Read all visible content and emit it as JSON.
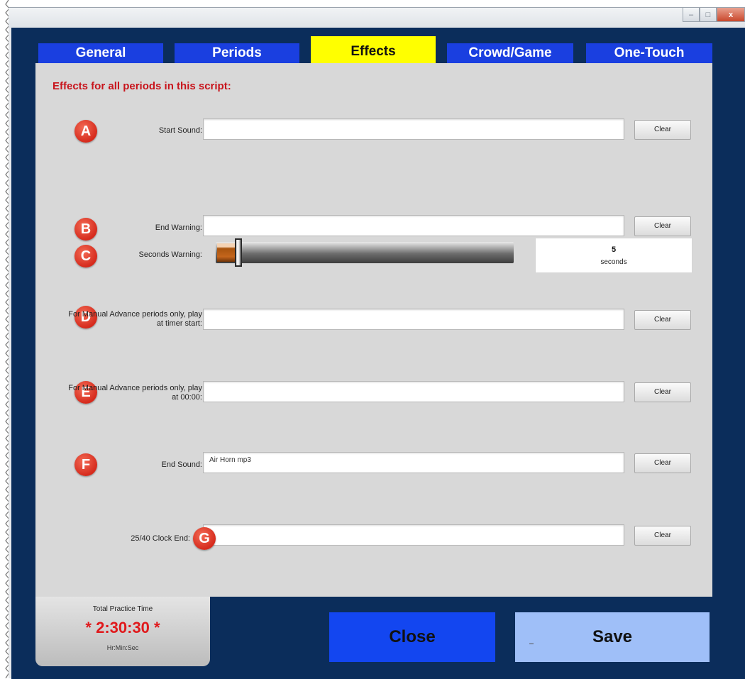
{
  "window": {
    "controls": {
      "minimize": "–",
      "maximize": "□",
      "close": "x"
    }
  },
  "tabs": [
    {
      "label": "General",
      "active": false
    },
    {
      "label": "Periods",
      "active": false
    },
    {
      "label": "Effects",
      "active": true
    },
    {
      "label": "Crowd/Game",
      "active": false
    },
    {
      "label": "One-Touch",
      "active": false
    }
  ],
  "panel": {
    "heading": "Effects for all periods in this script:",
    "rows": {
      "start_sound": {
        "badge": "A",
        "label": "Start Sound:",
        "value": "",
        "clear": "Clear"
      },
      "end_warning": {
        "badge": "B",
        "label": "End Warning:",
        "value": "",
        "clear": "Clear"
      },
      "seconds_warning": {
        "badge": "C",
        "label": "Seconds Warning:",
        "value": "5",
        "unit": "seconds",
        "fraction": 0.07
      },
      "manual_start": {
        "badge": "D",
        "label": "For Manual Advance periods only, play at timer start:",
        "value": "",
        "clear": "Clear"
      },
      "manual_end": {
        "badge": "E",
        "label": "For Manual Advance periods only, play at 00:00:",
        "value": "",
        "clear": "Clear"
      },
      "end_sound": {
        "badge": "F",
        "label": "End Sound:",
        "value": "Air Horn mp3",
        "clear": "Clear"
      },
      "clock_end": {
        "badge": "G",
        "label": "25/40 Clock End:",
        "value": "",
        "clear": "Clear"
      }
    }
  },
  "total": {
    "label": "Total Practice Time",
    "value": "* 2:30:30 *",
    "unit": "Hr:Min:Sec"
  },
  "buttons": {
    "close": "Close",
    "save": "Save"
  },
  "colors": {
    "frame": "#0b2d5b",
    "tab": "#1a3fe0",
    "tab_active": "#ffff00",
    "heading": "#c8141c",
    "badge": "#d62b1d",
    "total_value": "#e0191c",
    "close_button": "#1346f0",
    "save_button": "#9fbff8"
  }
}
